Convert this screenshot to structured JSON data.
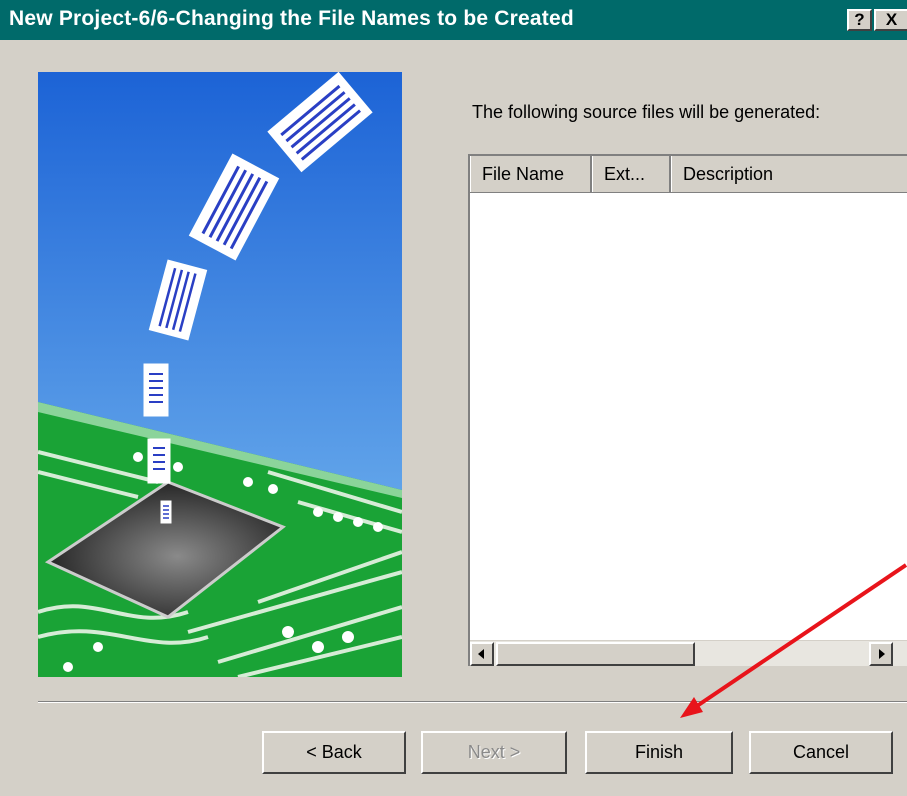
{
  "window": {
    "title": "New Project-6/6-Changing the File Names to be Created",
    "help_button": "?",
    "close_button": "X"
  },
  "label": "The following source files will be generated:",
  "listview": {
    "columns": [
      "File Name",
      "Ext...",
      "Description"
    ],
    "rows": []
  },
  "buttons": {
    "back": "< Back",
    "next": "Next >",
    "finish": "Finish",
    "cancel": "Cancel"
  },
  "annotation": {
    "arrow_color": "#e8141b",
    "arrow_target": "finish-button"
  }
}
